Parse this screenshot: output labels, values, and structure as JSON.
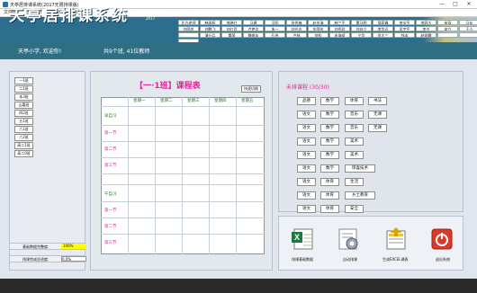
{
  "window": {
    "title": "天亭居排课系统(2017无限排课版)",
    "min": "—",
    "max": "□",
    "close": "✕"
  },
  "menu": [
    "文件(F)",
    "查看(C)",
    "功能(G)",
    "退出(T)"
  ],
  "app": {
    "title": "天亭居排课系统",
    "year": "2017"
  },
  "teachers_grid": [
    "比方老师",
    "韩承权",
    "李晓红",
    "马建",
    "汉阳",
    "张秀梅",
    "赵金海",
    "韩兰平",
    "董马明",
    "邱家鑫",
    "李宝平",
    "李四大",
    "宋双",
    "马友",
    "刘国忠",
    "刘鹏飞",
    "刘红武",
    "卢艳文",
    "朱一",
    "刘光志",
    "东国庆",
    "刘秀珍",
    "刘自立",
    "李华远",
    "吴宇平",
    "李五",
    "安立",
    "王小",
    "",
    "潘仕兵",
    "覃荣",
    "魏俊友",
    "孔伟",
    "卢林",
    "何松",
    "宋海斌",
    "宁华",
    "徐大三",
    "钱本",
    "赵刚霖",
    "",
    "",
    ""
  ],
  "status": {
    "welcome": "天亭小学, 欢迎你!",
    "summary": "共9个班, 41位教师"
  },
  "classes": [
    "一1班",
    "二1班",
    "本3班",
    "山嘉班",
    "四2班",
    "五1班",
    "六1班",
    "六2班",
    "高二1班",
    "高二0班"
  ],
  "stats": {
    "basic_label": "基础数据完整度:",
    "basic_value": "100%",
    "progress_label": "排课完成总进度:",
    "progress_value": "0.0%"
  },
  "schedule": {
    "title": "【一·1班】课程表",
    "quick_btn": "快速切换",
    "days": [
      "星期一",
      "星期二",
      "星期三",
      "星期四",
      "星期五"
    ],
    "morning": [
      "早自习",
      "第一节",
      "第二节",
      "第三节"
    ],
    "afternoon": [
      "午自习",
      "第一节",
      "第二节",
      "第三节"
    ]
  },
  "unscheduled": {
    "title": "未排课程 (30/30)",
    "rows": [
      [
        "品德",
        "数学",
        "体育",
        "书法"
      ],
      [
        "语文",
        "数学",
        "音乐",
        "无课"
      ],
      [
        "语文",
        "数学",
        "音乐",
        "无课"
      ],
      [
        "语文",
        "数学",
        "美术"
      ],
      [
        "语文",
        "数学",
        "美术"
      ],
      [
        "语文",
        "数学",
        "惊喜技术"
      ],
      [
        "语文",
        "体育",
        "生活"
      ],
      [
        "语文",
        "体育",
        "乡土教育"
      ],
      [
        "语文",
        "体育",
        "安全"
      ]
    ]
  },
  "tools": {
    "excel": "排课基础数据",
    "auto": "自动排课",
    "export": "生成EXCEL课表",
    "exit": "退出系统"
  }
}
